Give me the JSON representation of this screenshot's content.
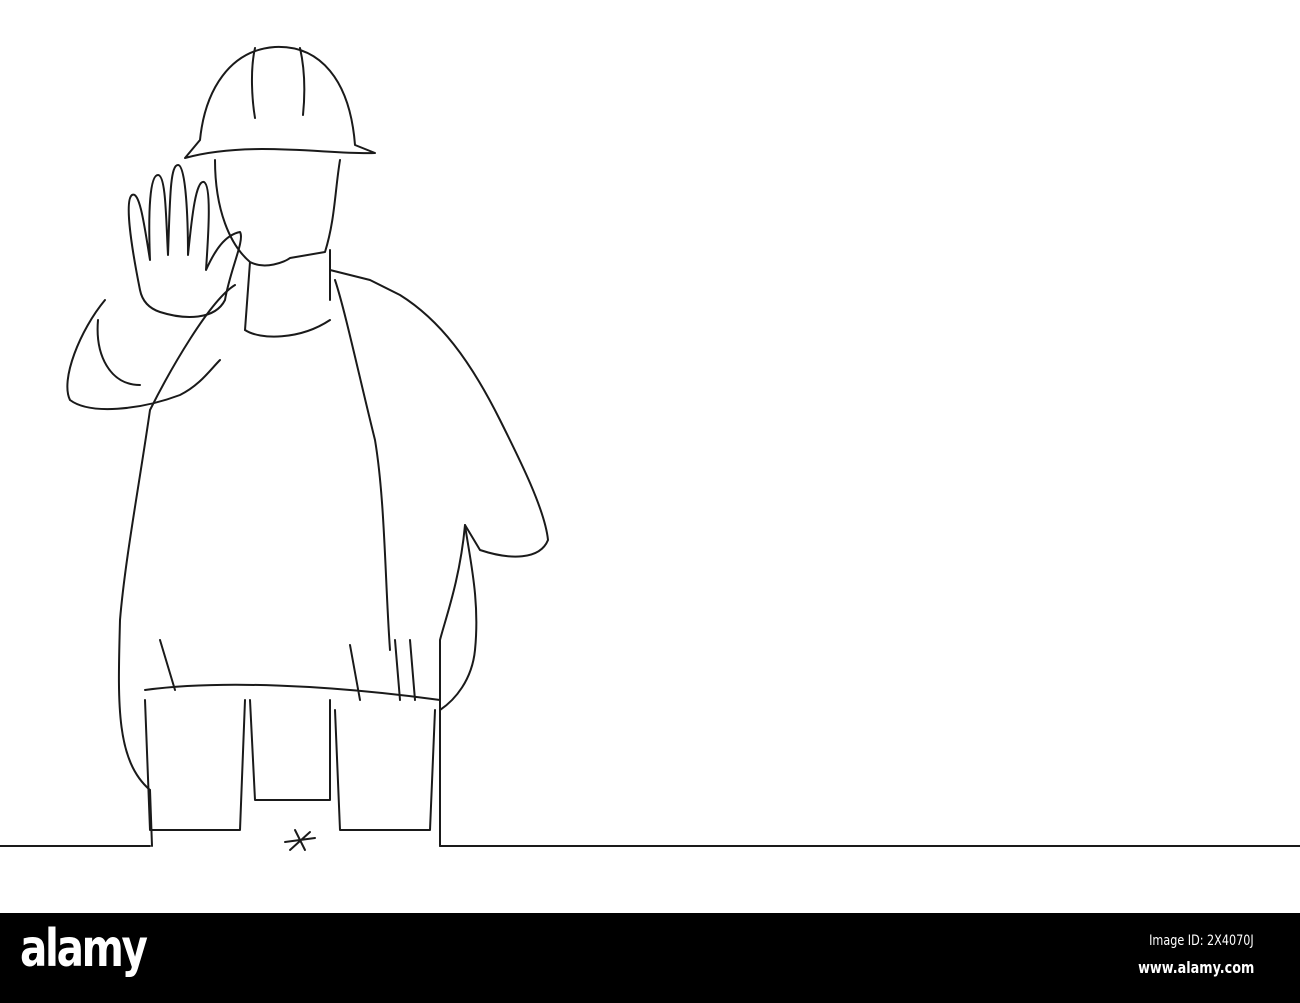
{
  "illustration": {
    "subject": "construction-worker-stop-gesture",
    "stroke_color": "#1a1a1a",
    "background": "#ffffff"
  },
  "footer": {
    "logo_text": "alamy",
    "image_id": "Image ID: 2X4070J",
    "url": "www.alamy.com",
    "background": "#000000"
  }
}
